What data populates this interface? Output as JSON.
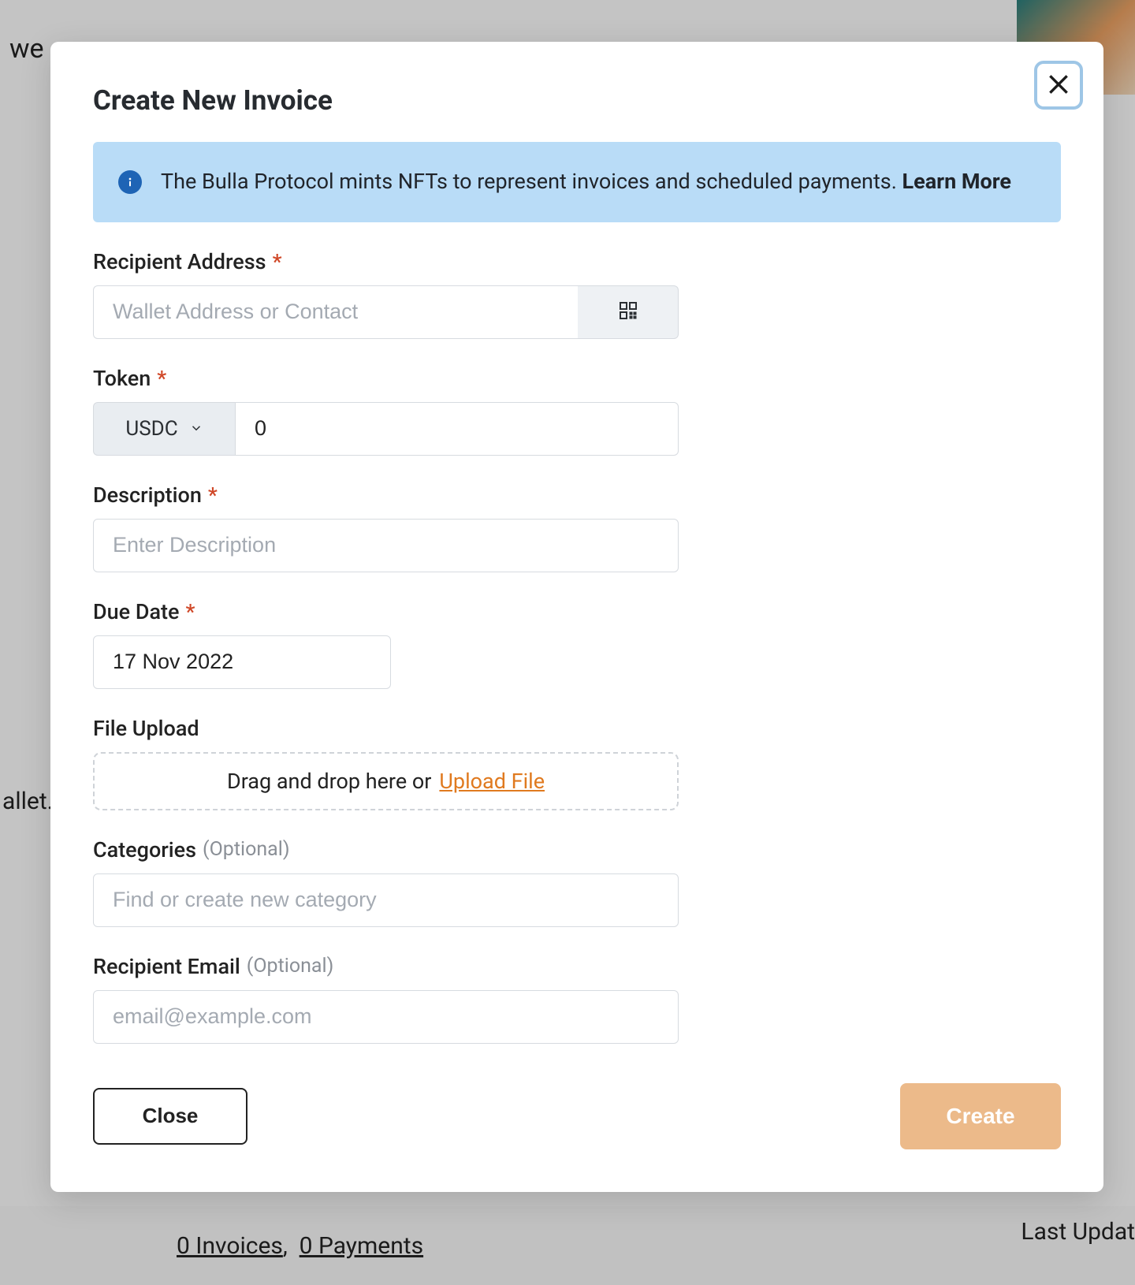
{
  "bg": {
    "text1": "we",
    "text2": "allet.",
    "invoices": "0 Invoices",
    "payments": "0 Payments",
    "last_updated": "Last Updat"
  },
  "modal": {
    "title": "Create New Invoice",
    "info_text": "The Bulla Protocol mints NFTs to represent invoices and scheduled payments. ",
    "learn_more": "Learn More",
    "labels": {
      "recipient": "Recipient Address",
      "token": "Token",
      "description": "Description",
      "due_date": "Due Date",
      "file_upload": "File Upload",
      "categories": "Categories",
      "recipient_email": "Recipient Email",
      "optional": "(Optional)"
    },
    "placeholders": {
      "recipient": "Wallet Address or Contact",
      "description": "Enter Description",
      "categories": "Find or create new category",
      "email": "email@example.com"
    },
    "values": {
      "token_select": "USDC",
      "token_amount": "0",
      "due_date": "17 Nov 2022"
    },
    "upload": {
      "drag_text": "Drag and drop here or",
      "link_text": "Upload File"
    },
    "buttons": {
      "close": "Close",
      "create": "Create"
    }
  }
}
